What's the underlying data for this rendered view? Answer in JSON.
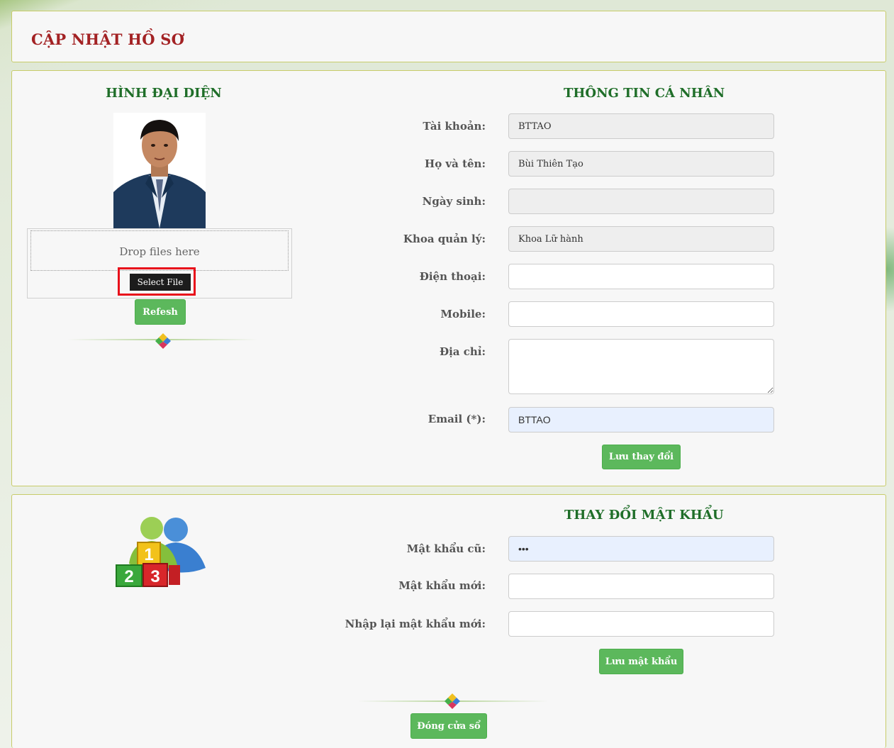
{
  "header": {
    "title": "CẬP NHẬT HỒ SƠ"
  },
  "avatar_section": {
    "title": "HÌNH ĐẠI DIỆN",
    "dropzone_text": "Drop files here",
    "select_file_label": "Select File",
    "refresh_label": "Refesh"
  },
  "personal_info": {
    "title": "THÔNG TIN CÁ NHÂN",
    "fields": {
      "account": {
        "label": "Tài khoản:",
        "value": "BTTAO"
      },
      "fullname": {
        "label": "Họ và tên:",
        "value": "Bùi Thiên Tạo"
      },
      "birthdate": {
        "label": "Ngày sinh:",
        "value": ""
      },
      "faculty": {
        "label": "Khoa quản lý:",
        "value": "Khoa Lữ hành"
      },
      "phone": {
        "label": "Điện thoại:",
        "value": ""
      },
      "mobile": {
        "label": "Mobile:",
        "value": ""
      },
      "address": {
        "label": "Địa chỉ:",
        "value": ""
      },
      "email": {
        "label": "Email (*):",
        "value": "BTTAO"
      }
    },
    "save_label": "Lưu thay đổi"
  },
  "password_section": {
    "title": "THAY ĐỔI MẬT KHẨU",
    "fields": {
      "old": {
        "label": "Mật khẩu cũ:",
        "value": "•••"
      },
      "new": {
        "label": "Mật khẩu mới:",
        "value": ""
      },
      "confirm": {
        "label": "Nhập lại mật khẩu mới:",
        "value": ""
      }
    },
    "save_label": "Lưu mật khẩu",
    "close_label": "Đóng cửa sổ"
  },
  "colors": {
    "title_red": "#a32224",
    "section_green": "#1f6e29",
    "button_green": "#5cb85c",
    "panel_border": "#c8cc6a"
  }
}
